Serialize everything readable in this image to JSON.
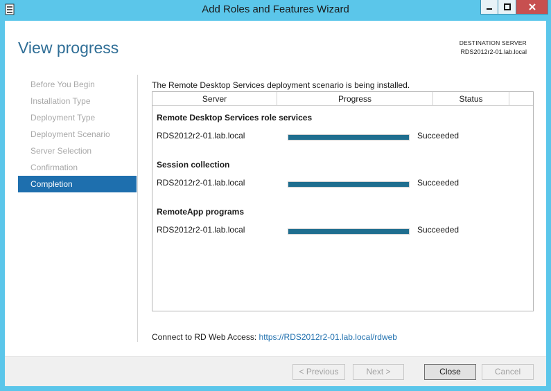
{
  "window": {
    "title": "Add Roles and Features Wizard"
  },
  "header": {
    "page_title": "View progress",
    "destination_label": "DESTINATION SERVER",
    "destination_server": "RDS2012r2-01.lab.local"
  },
  "nav": {
    "items": [
      {
        "label": "Before You Begin",
        "active": false
      },
      {
        "label": "Installation Type",
        "active": false
      },
      {
        "label": "Deployment Type",
        "active": false
      },
      {
        "label": "Deployment Scenario",
        "active": false
      },
      {
        "label": "Server Selection",
        "active": false
      },
      {
        "label": "Confirmation",
        "active": false
      },
      {
        "label": "Completion",
        "active": true
      }
    ]
  },
  "main": {
    "scenario_text": "The Remote Desktop Services deployment scenario is being installed.",
    "columns": [
      "Server",
      "Progress",
      "Status"
    ],
    "sections": [
      {
        "title": "Remote Desktop Services role services",
        "server": "RDS2012r2-01.lab.local",
        "progress": 1.0,
        "status": "Succeeded"
      },
      {
        "title": "Session collection",
        "server": "RDS2012r2-01.lab.local",
        "progress": 1.0,
        "status": "Succeeded"
      },
      {
        "title": "RemoteApp programs",
        "server": "RDS2012r2-01.lab.local",
        "progress": 1.0,
        "status": "Succeeded"
      }
    ],
    "rdweb_label": "Connect to RD Web Access:",
    "rdweb_link": "https://RDS2012r2-01.lab.local/rdweb"
  },
  "footer": {
    "previous_label": "< Previous",
    "next_label": "Next >",
    "close_label": "Close",
    "cancel_label": "Cancel"
  },
  "colors": {
    "accent": "#1e6fae",
    "progress_fill": "#1f6e8f",
    "frame": "#5bc6ea"
  }
}
